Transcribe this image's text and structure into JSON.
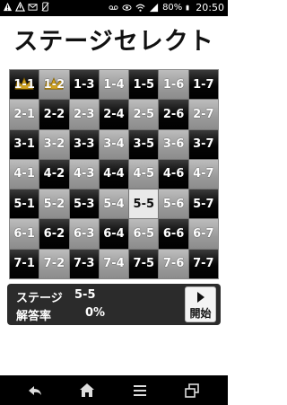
{
  "status_bar": {
    "battery": "80%",
    "time": "20:50",
    "icons": [
      "warning-icon",
      "alert-icon",
      "mail-icon",
      "phone-icon",
      "voicemail-icon",
      "eye-icon",
      "wifi-icon",
      "signal-icon",
      "battery-icon"
    ]
  },
  "title": "ステージセレクト",
  "grid": {
    "selected": "5-5",
    "cells": [
      [
        "1-1",
        "1-2",
        "1-3",
        "1-4",
        "1-5",
        "1-6",
        "1-7"
      ],
      [
        "2-1",
        "2-2",
        "2-3",
        "2-4",
        "2-5",
        "2-6",
        "2-7"
      ],
      [
        "3-1",
        "3-2",
        "3-3",
        "3-4",
        "3-5",
        "3-6",
        "3-7"
      ],
      [
        "4-1",
        "4-2",
        "4-3",
        "4-4",
        "4-5",
        "4-6",
        "4-7"
      ],
      [
        "5-1",
        "5-2",
        "5-3",
        "5-4",
        "5-5",
        "5-6",
        "5-7"
      ],
      [
        "6-1",
        "6-2",
        "6-3",
        "6-4",
        "6-5",
        "6-6",
        "6-7"
      ],
      [
        "7-1",
        "7-2",
        "7-3",
        "7-4",
        "7-5",
        "7-6",
        "7-7"
      ]
    ],
    "crowned": [
      "1-1",
      "1-2"
    ]
  },
  "info": {
    "stage_label": "ステージ",
    "stage_value": "5-5",
    "rate_label": "解答率",
    "rate_value": "0%"
  },
  "start_button": {
    "label": "開始",
    "icon": "play-icon"
  },
  "nav": [
    "back-icon",
    "home-icon",
    "menu-icon",
    "recent-apps-icon"
  ]
}
